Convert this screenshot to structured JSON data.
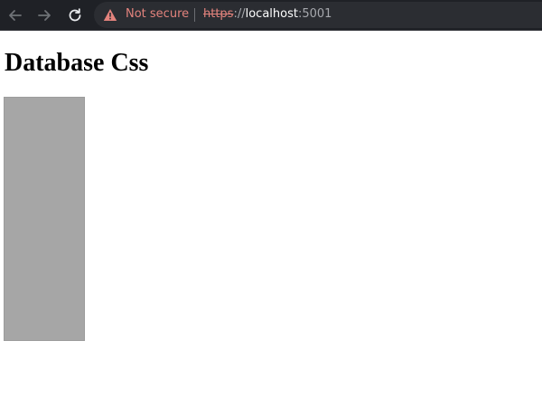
{
  "browser": {
    "security_label": "Not secure",
    "url": {
      "scheme": "https",
      "separator": "://",
      "host": "localhost",
      "port": ":5001"
    },
    "icons": {
      "back": "arrow-left-icon",
      "forward": "arrow-right-icon",
      "reload": "reload-icon",
      "warning": "warning-triangle-icon"
    }
  },
  "page": {
    "title": "Database Css",
    "box_color": "#a6a6a6"
  }
}
